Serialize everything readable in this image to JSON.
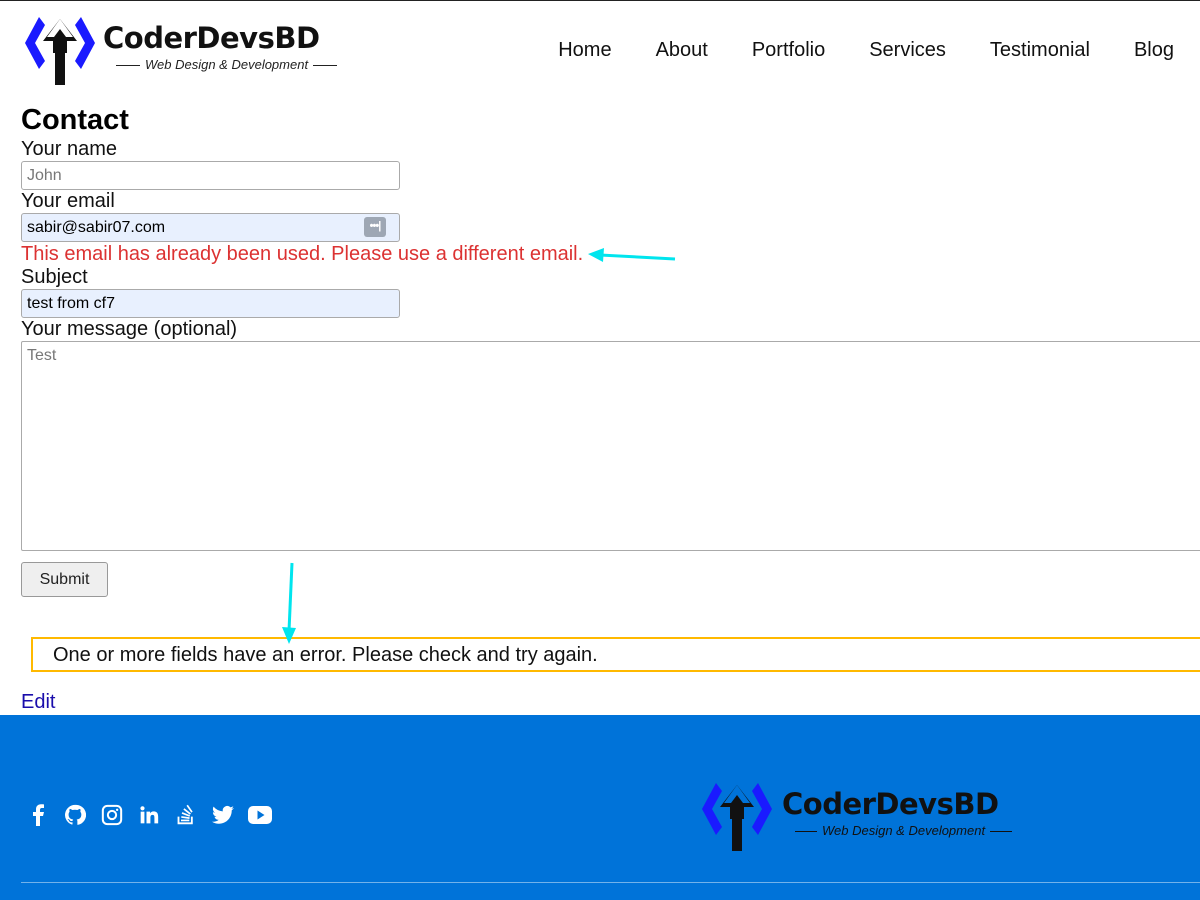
{
  "brand": {
    "name": "CoderDevsBD",
    "tagline": "Web Design & Development"
  },
  "nav": {
    "items": [
      "Home",
      "About",
      "Portfolio",
      "Services",
      "Testimonial",
      "Blog"
    ]
  },
  "page": {
    "title": "Contact"
  },
  "form": {
    "name_label": "Your name",
    "name_placeholder": "John",
    "email_label": "Your email",
    "email_value": "sabir@sabir07.com",
    "email_error": "This email has already been used. Please use a different email.",
    "subject_label": "Subject",
    "subject_value": "test from cf7",
    "message_label": "Your message (optional)",
    "message_placeholder": "Test",
    "submit_label": "Submit",
    "response_notice": "One or more fields have an error. Please check and try again."
  },
  "edit_link": "Edit",
  "footer": {
    "social_icons": [
      "facebook-icon",
      "github-icon",
      "instagram-icon",
      "linkedin-icon",
      "stackoverflow-icon",
      "twitter-icon",
      "youtube-icon"
    ]
  },
  "colors": {
    "error": "#dc3232",
    "notice_border": "#ffb900",
    "footer_bg": "#0073d9",
    "annotation_arrow": "#00e5ee",
    "logo_blue": "#1a1aff"
  }
}
